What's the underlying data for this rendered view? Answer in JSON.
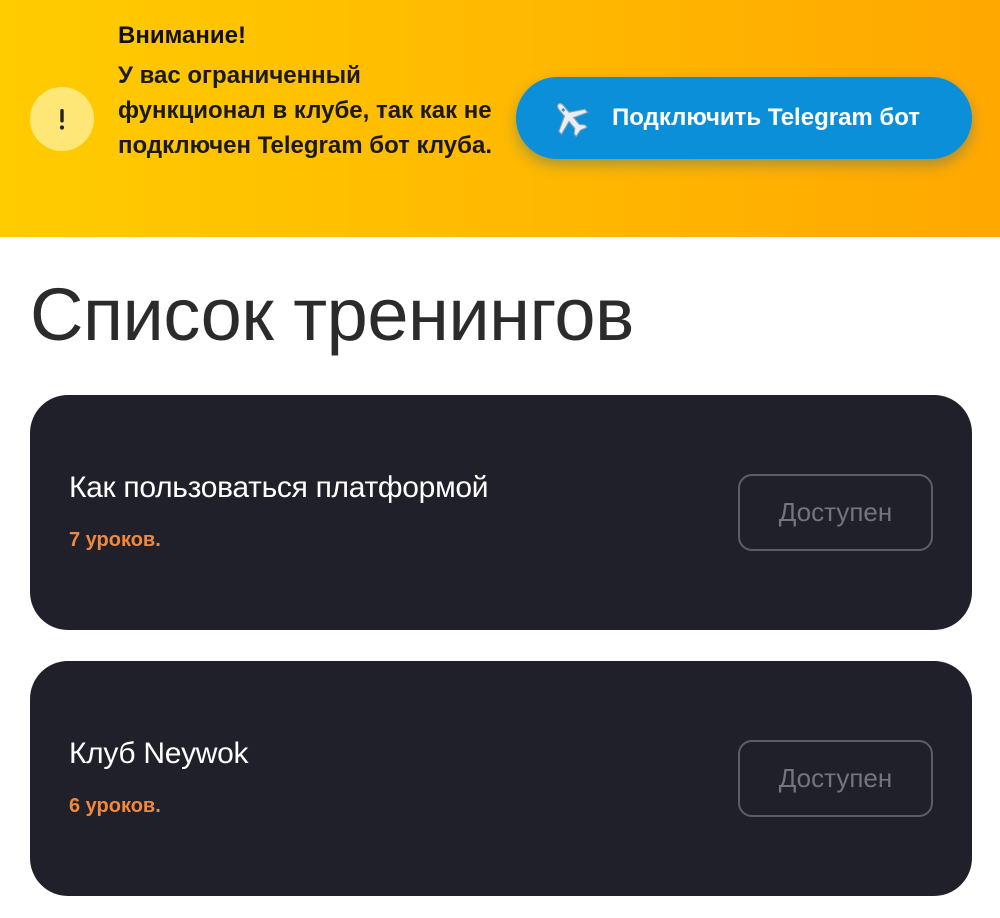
{
  "banner": {
    "title": "Внимание!",
    "message": "У вас ограниченный функционал в клубе, так как не подключен Telegram бот клуба.",
    "warning_icon": "warning-exclamation",
    "connect_button": {
      "label": "Подключить Telegram бот",
      "icon": "airplane-icon",
      "color": "#0b8fd9"
    },
    "background_color": "#ffbf00"
  },
  "page": {
    "title": "Список тренингов"
  },
  "trainings": [
    {
      "title": "Как пользоваться платформой",
      "lessons": "7 уроков.",
      "status": "Доступен"
    },
    {
      "title": "Клуб Neywok",
      "lessons": "6 уроков.",
      "status": "Доступен"
    }
  ],
  "colors": {
    "card_background": "#20202b",
    "lesson_count": "#f0883e",
    "status_text": "#74747c"
  }
}
